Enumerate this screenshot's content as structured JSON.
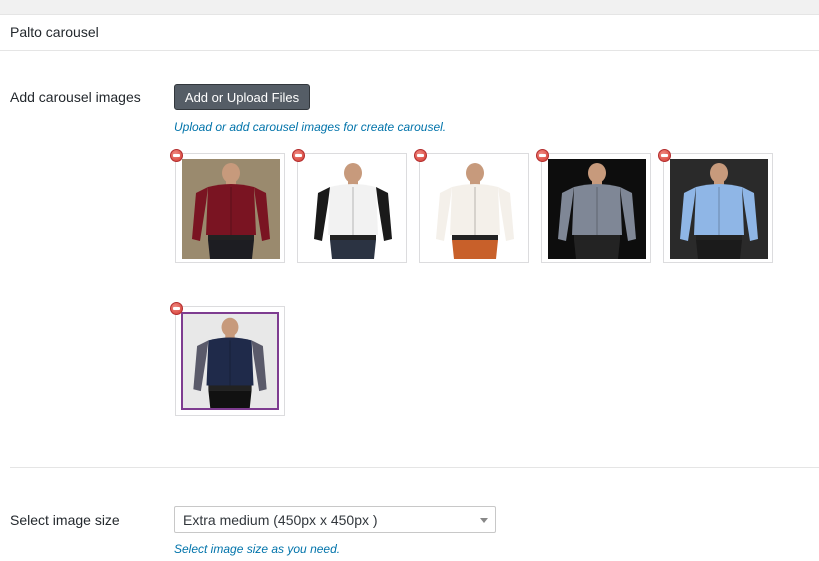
{
  "panel": {
    "title": "Palto carousel"
  },
  "carousel": {
    "label": "Add carousel images",
    "upload_button": "Add or Upload Files",
    "help": "Upload or add carousel images for create carousel.",
    "images": [
      {
        "name": "maroon-shirt-image",
        "bg": "#9a8a6e",
        "shirt": "#7a1422",
        "sleeve": "#7a1422",
        "pants": "#1d1d22"
      },
      {
        "name": "white-black-shirt-image",
        "bg": "#ffffff",
        "shirt": "#f2f2f2",
        "sleeve": "#1a1a1a",
        "pants": "#2b3342"
      },
      {
        "name": "navy-white-striped-shirt-image",
        "bg": "#ffffff",
        "shirt": "#f4f0ea",
        "sleeve": "#f4f0ea",
        "pants": "#c8602a"
      },
      {
        "name": "grey-shirt-image",
        "bg": "#0d0d0d",
        "shirt": "#7f8796",
        "sleeve": "#7f8796",
        "pants": "#232323"
      },
      {
        "name": "light-blue-shirt-image",
        "bg": "#2a2a2a",
        "shirt": "#8fb6e6",
        "sleeve": "#8fb6e6",
        "pants": "#1b1b1b"
      },
      {
        "name": "navy-shirt-image",
        "bg": "#e8e8e8",
        "shirt": "#1f2a4a",
        "sleeve": "#5a5a6a",
        "pants": "#111111"
      }
    ]
  },
  "image_size": {
    "label": "Select image size",
    "selected": "Extra medium (450px x 450px )",
    "help": "Select image size as you need."
  },
  "colors": {
    "accent": "#0073aa",
    "button": "#555d66",
    "selected_border": "#7e3c90",
    "remove": "#d3392f"
  }
}
